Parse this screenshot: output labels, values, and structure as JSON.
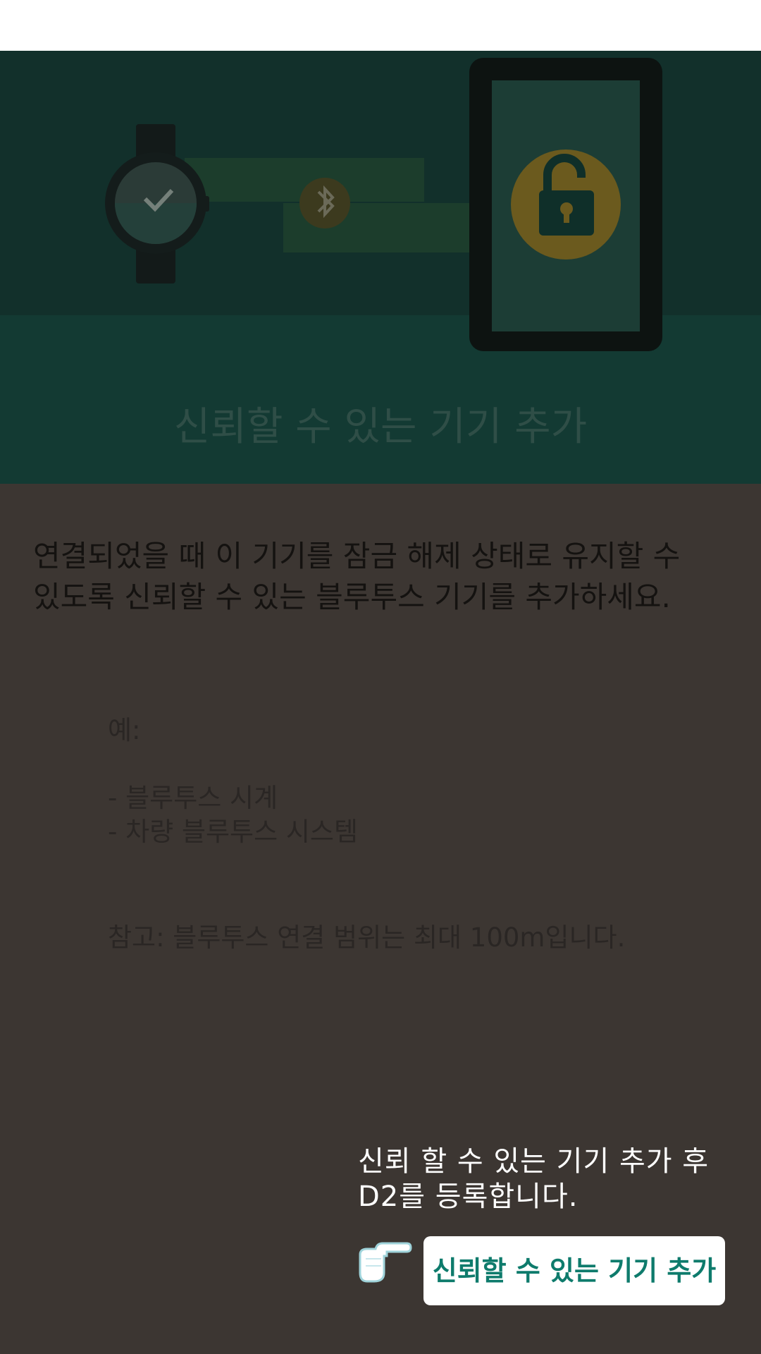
{
  "hero": {
    "title": "신뢰할 수 있는 기기 추가",
    "icons": [
      "watch-icon",
      "bluetooth-icon",
      "tablet-icon",
      "unlock-icon"
    ]
  },
  "main": {
    "description": "연결되었을 때 이 기기를 잠금 해제 상태로 유지할 수 있도록 신뢰할 수 있는 블루투스 기기를 추가하세요.",
    "examples": {
      "label": "예:",
      "items": [
        "- 블루투스 시계",
        "- 차량 블루투스 시스템"
      ]
    },
    "note": "참고: 블루투스 연결 범위는 최대 100m입니다."
  },
  "overlay": {
    "hint": "신뢰 할 수 있는 기기 추가 후 D2를 등록합니다.",
    "button_label": "신뢰할 수 있는 기기 추가",
    "pointer_icon": "pointing-hand-icon"
  },
  "colors": {
    "hero_bg": "#12302b",
    "content_bg": "#3c3632",
    "accent": "#0e7b6c",
    "unlock_circle": "#6b5a1e"
  }
}
